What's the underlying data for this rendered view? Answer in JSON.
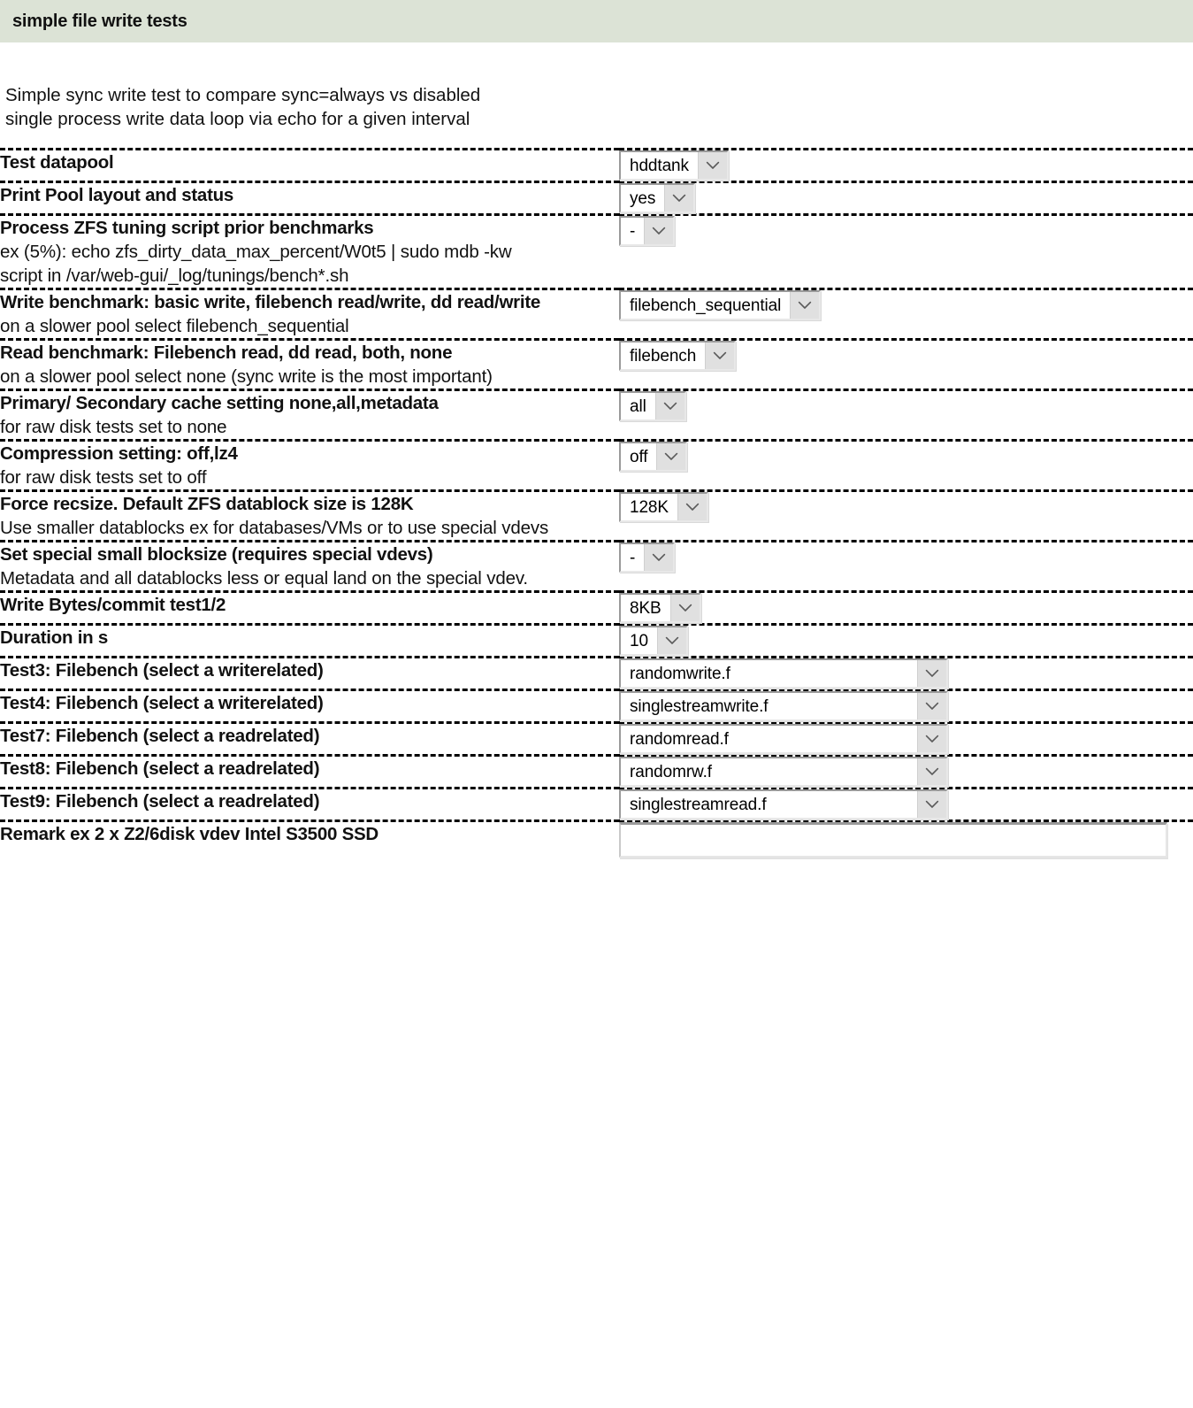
{
  "header": {
    "title": "simple file write tests"
  },
  "intro": {
    "line1": "Simple sync write test to compare sync=always vs disabled",
    "line2": "single process write data loop via echo for a given interval"
  },
  "icons": {
    "chevron_down": "chevron-down-icon"
  },
  "rows": [
    {
      "name": "test-datapool",
      "label": "Test datapool",
      "sub": "",
      "field_type": "select",
      "value": "hddtank",
      "width": "auto"
    },
    {
      "name": "print-pool-layout-and-status",
      "label": "Print Pool layout and status",
      "sub": "",
      "field_type": "select",
      "value": "yes",
      "width": "auto"
    },
    {
      "name": "process-zfs-tuning-script",
      "label": "Process ZFS tuning script prior benchmarks",
      "sub": "ex (5%): echo zfs_dirty_data_max_percent/W0t5 | sudo mdb -kw\nscript in /var/web-gui/_log/tunings/bench*.sh",
      "field_type": "select",
      "value": "-",
      "width": "auto"
    },
    {
      "name": "write-benchmark",
      "label": "Write benchmark: basic write, filebench read/write, dd read/write",
      "sub": "on a slower pool select filebench_sequential",
      "field_type": "select",
      "value": "filebench_sequential",
      "width": "auto"
    },
    {
      "name": "read-benchmark",
      "label": "Read benchmark: Filebench read, dd read, both, none",
      "sub": "on a slower pool select none (sync write is the most important)",
      "field_type": "select",
      "value": "filebench",
      "width": "auto"
    },
    {
      "name": "primary-secondary-cache-setting",
      "label": "Primary/ Secondary cache setting none,all,metadata",
      "sub": "for raw disk tests set to none",
      "field_type": "select",
      "value": "all",
      "width": "auto"
    },
    {
      "name": "compression-setting",
      "label": "Compression setting: off,lz4",
      "sub": "for raw disk tests set to off",
      "field_type": "select",
      "value": "off",
      "width": "auto"
    },
    {
      "name": "force-recsize",
      "label": "Force recsize. Default ZFS datablock size is 128K",
      "sub": "Use smaller datablocks ex for databases/VMs or to use special vdevs",
      "field_type": "select",
      "value": "128K",
      "width": "auto"
    },
    {
      "name": "special-small-blocksize",
      "label": "Set special small blocksize (requires special vdevs)",
      "sub": "Metadata and all datablocks less or equal land on the special vdev.",
      "field_type": "select",
      "value": "-",
      "width": "auto"
    },
    {
      "name": "write-bytes-commit",
      "label": "Write Bytes/commit test1/2",
      "sub": "",
      "field_type": "select",
      "value": "8KB",
      "width": "auto"
    },
    {
      "name": "duration-in-s",
      "label": "Duration in s",
      "sub": "",
      "field_type": "select",
      "value": "10",
      "width": "auto"
    },
    {
      "name": "test3-filebench",
      "label": "Test3: Filebench (select a writerelated)",
      "sub": "",
      "field_type": "select",
      "value": "randomwrite.f",
      "width": "wide"
    },
    {
      "name": "test4-filebench",
      "label": "Test4: Filebench (select a writerelated)",
      "sub": "",
      "field_type": "select",
      "value": "singlestreamwrite.f",
      "width": "wide"
    },
    {
      "name": "test7-filebench",
      "label": "Test7: Filebench (select a readrelated)",
      "sub": "",
      "field_type": "select",
      "value": "randomread.f",
      "width": "wide"
    },
    {
      "name": "test8-filebench",
      "label": "Test8: Filebench (select a readrelated)",
      "sub": "",
      "field_type": "select",
      "value": "randomrw.f",
      "width": "wide"
    },
    {
      "name": "test9-filebench",
      "label": "Test9: Filebench (select a readrelated)",
      "sub": "",
      "field_type": "select",
      "value": "singlestreamread.f",
      "width": "wide"
    },
    {
      "name": "remark",
      "label": "Remark ex 2 x Z2/6disk vdev Intel S3500 SSD",
      "sub": "",
      "field_type": "text",
      "value": "",
      "placeholder": "",
      "width": "wide"
    }
  ],
  "colors": {
    "header_background": "#dce3d6",
    "text": "#111111",
    "separator": "#000000",
    "select_border_dark": "#9a9a9a",
    "select_arrow_background": "#e0e0e0",
    "page_background": "#ffffff"
  }
}
